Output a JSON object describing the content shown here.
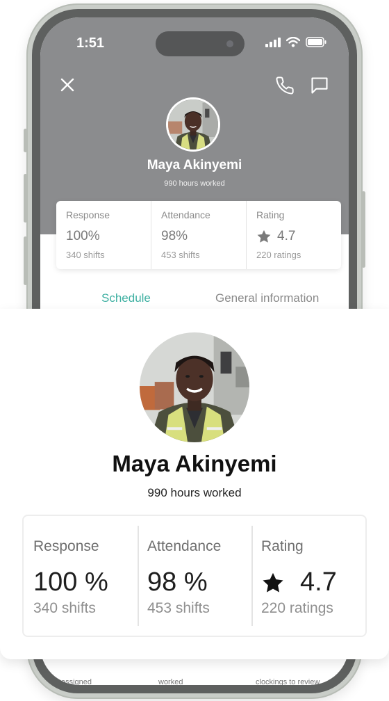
{
  "status_bar": {
    "time": "1:51"
  },
  "profile": {
    "name": "Maya Akinyemi",
    "hours": "990 hours worked"
  },
  "small_stats": [
    {
      "label": "Response",
      "value": "100%",
      "sub": "340 shifts"
    },
    {
      "label": "Attendance",
      "value": "98%",
      "sub": "453 shifts"
    },
    {
      "label": "Rating",
      "value": "4.7",
      "sub": "220 ratings"
    }
  ],
  "tabs": {
    "schedule": "Schedule",
    "general": "General information"
  },
  "bottom_labels": [
    "assigned",
    "worked",
    "clockings to review"
  ],
  "big_stats": [
    {
      "label": "Response",
      "value": "100 %",
      "sub": "340 shifts"
    },
    {
      "label": "Attendance",
      "value": "98 %",
      "sub": "453 shifts"
    },
    {
      "label": "Rating",
      "value": "4.7",
      "sub": "220 ratings"
    }
  ],
  "colors": {
    "accent": "#3fb0a2",
    "header_bg": "#8b8c8e"
  },
  "icons": [
    "close-icon",
    "phone-icon",
    "chat-icon",
    "signal-icon",
    "wifi-icon",
    "battery-icon",
    "star-icon"
  ]
}
